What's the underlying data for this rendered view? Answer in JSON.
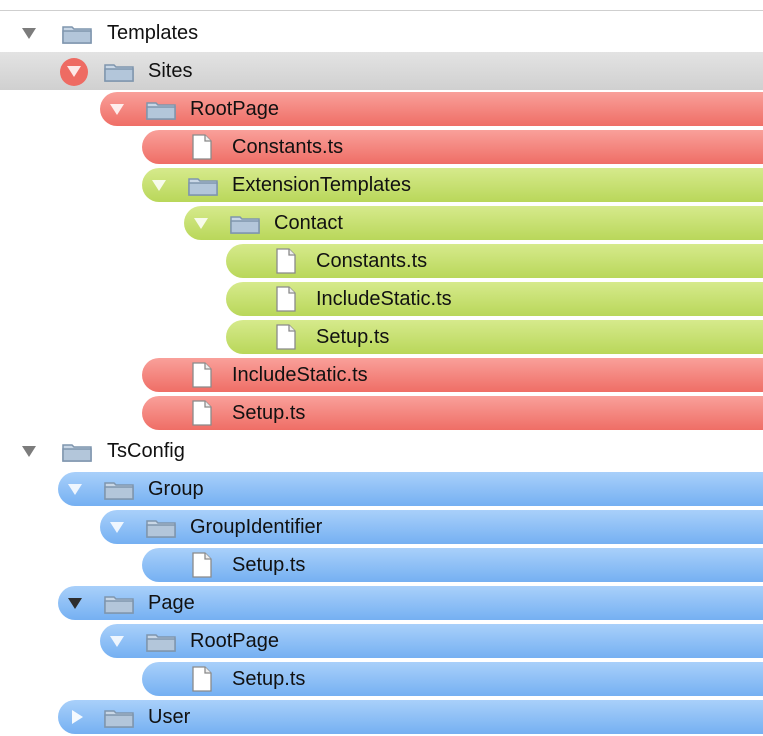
{
  "tree": {
    "items": [
      {
        "label": "Templates"
      },
      {
        "label": "Sites"
      },
      {
        "label": "RootPage"
      },
      {
        "label": "Constants.ts"
      },
      {
        "label": "ExtensionTemplates"
      },
      {
        "label": "Contact"
      },
      {
        "label": "Constants.ts"
      },
      {
        "label": "IncludeStatic.ts"
      },
      {
        "label": "Setup.ts"
      },
      {
        "label": "IncludeStatic.ts"
      },
      {
        "label": "Setup.ts"
      },
      {
        "label": "TsConfig"
      },
      {
        "label": "Group"
      },
      {
        "label": "GroupIdentifier"
      },
      {
        "label": "Setup.ts"
      },
      {
        "label": "Page"
      },
      {
        "label": "RootPage"
      },
      {
        "label": "Setup.ts"
      },
      {
        "label": "User"
      }
    ]
  },
  "colors": {
    "red_label": "#ef6e66",
    "green_label": "#b9d75a",
    "blue_label": "#75b0f2",
    "selection_gray": "#d6d6d6"
  },
  "icons": {
    "folder": "folder-icon",
    "file": "file-icon",
    "expanded": "disclosure-triangle-down-icon",
    "collapsed": "disclosure-triangle-right-icon"
  }
}
